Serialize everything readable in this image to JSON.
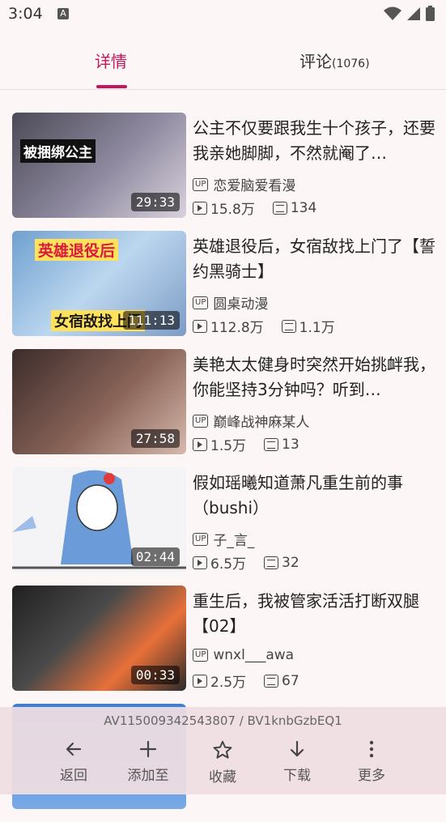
{
  "status_bar": {
    "time": "3:04",
    "notification_icon": "A"
  },
  "tabs": [
    {
      "label": "详情",
      "active": true
    },
    {
      "label": "评论",
      "count": "(1076)"
    }
  ],
  "colors": {
    "accent": "#c2185b"
  },
  "videos": [
    {
      "title": "公主不仅要跟我生十个孩子，还要我亲她脚脚，不然就阉了…",
      "up": "恋爱脑爱看漫",
      "views": "15.8万",
      "danmaku": "134",
      "duration": "29:33",
      "thumb_bg": "#5b5a66"
    },
    {
      "title": "英雄退役后，女宿敌找上门了【誓约黑骑士】",
      "up": "圆桌动漫",
      "views": "112.8万",
      "danmaku": "1.1万",
      "duration": "111:13",
      "thumb_bg": "#8fb4d8"
    },
    {
      "title": "美艳太太健身时突然开始挑衅我，你能坚持3分钟吗？听到…",
      "up": "巅峰战神麻某人",
      "views": "1.5万",
      "danmaku": "13",
      "duration": "27:58",
      "thumb_bg": "#6b4a44"
    },
    {
      "title": "假如瑶曦知道萧凡重生前的事（bushi）",
      "up": "子_言_",
      "views": "6.5万",
      "danmaku": "32",
      "duration": "02:44",
      "thumb_bg": "#f2f2f4"
    },
    {
      "title": "重生后，我被管家活活打断双腿【02】",
      "up": "wnxl___awa",
      "views": "2.5万",
      "danmaku": "67",
      "duration": "00:33",
      "thumb_bg": "#3a3a3a"
    }
  ],
  "thumb_texts": [
    "被捆绑公主",
    "英雄退役后",
    "女宿敌找上门"
  ],
  "bottom": {
    "id_text": "AV115009342543807 / BV1knbGzbEQ1",
    "actions": [
      "返回",
      "添加至",
      "收藏",
      "下载",
      "更多"
    ]
  }
}
